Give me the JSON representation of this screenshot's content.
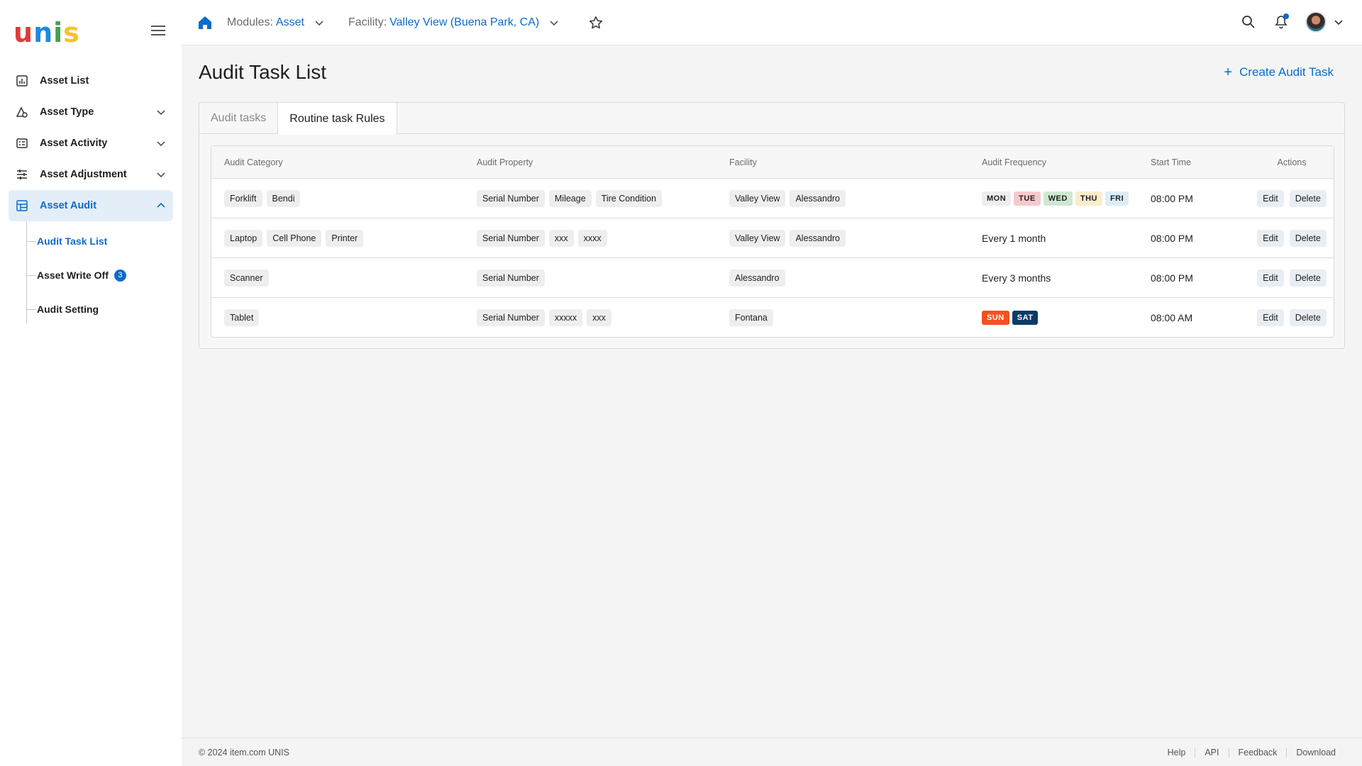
{
  "brand": {
    "letters": [
      {
        "ch": "u",
        "color": "#e53935"
      },
      {
        "ch": "n",
        "color": "#1e88e5"
      },
      {
        "ch": "i",
        "color": "#43a047"
      },
      {
        "ch": "s",
        "color": "#fbc02d"
      }
    ]
  },
  "sidebar": {
    "items": [
      {
        "label": "Asset List",
        "icon": "bar-chart-icon"
      },
      {
        "label": "Asset Type",
        "icon": "shapes-icon"
      },
      {
        "label": "Asset Activity",
        "icon": "activity-list-icon"
      },
      {
        "label": "Asset Adjustment",
        "icon": "sliders-icon"
      },
      {
        "label": "Asset Audit",
        "icon": "grid-icon"
      }
    ],
    "sub_items": [
      {
        "label": "Audit Task List"
      },
      {
        "label": "Asset Write Off",
        "badge": "3"
      },
      {
        "label": "Audit Setting"
      }
    ]
  },
  "topbar": {
    "modules_label": "Modules:",
    "modules_value": "Asset",
    "facility_label": "Facility:",
    "facility_value": "Valley View (Buena Park, CA)"
  },
  "page": {
    "title": "Audit Task List",
    "create_button": "Create Audit Task",
    "tabs": [
      "Audit tasks",
      "Routine task Rules"
    ],
    "active_tab": 1
  },
  "table": {
    "headers": [
      "Audit Category",
      "Audit Property",
      "Facility",
      "Audit Frequency",
      "Start Time",
      "Actions"
    ],
    "edit_label": "Edit",
    "delete_label": "Delete",
    "day_colors": {
      "MON": {
        "bg": "#eeeeee",
        "fg": "#1f1f1f"
      },
      "TUE": {
        "bg": "#f8c9cc",
        "fg": "#1f1f1f"
      },
      "WED": {
        "bg": "#cfe8d2",
        "fg": "#1f1f1f"
      },
      "THU": {
        "bg": "#fbeccb",
        "fg": "#1f1f1f"
      },
      "FRI": {
        "bg": "#dcedf8",
        "fg": "#1f1f1f"
      },
      "SUN": {
        "bg": "#f4511e",
        "fg": "#ffffff"
      },
      "SAT": {
        "bg": "#0d3b66",
        "fg": "#ffffff"
      }
    },
    "rows": [
      {
        "category": [
          "Forklift",
          "Bendi"
        ],
        "property": [
          "Serial Number",
          "Mileage",
          "Tire Condition"
        ],
        "facility": [
          "Valley View",
          "Alessandro"
        ],
        "frequency_days": [
          "MON",
          "TUE",
          "WED",
          "THU",
          "FRI"
        ],
        "frequency_text": "",
        "start_time": "08:00 PM"
      },
      {
        "category": [
          "Laptop",
          "Cell Phone",
          "Printer"
        ],
        "property": [
          "Serial Number",
          "xxx",
          "xxxx"
        ],
        "facility": [
          "Valley View",
          "Alessandro"
        ],
        "frequency_days": [],
        "frequency_text": "Every 1 month",
        "start_time": "08:00 PM"
      },
      {
        "category": [
          "Scanner"
        ],
        "property": [
          "Serial Number"
        ],
        "facility": [
          "Alessandro"
        ],
        "frequency_days": [],
        "frequency_text": "Every 3 months",
        "start_time": "08:00 PM"
      },
      {
        "category": [
          "Tablet"
        ],
        "property": [
          "Serial Number",
          "xxxxx",
          "xxx"
        ],
        "facility": [
          "Fontana"
        ],
        "frequency_days": [
          "SUN",
          "SAT"
        ],
        "frequency_text": "",
        "start_time": "08:00 AM"
      }
    ]
  },
  "footer": {
    "copyright": "© 2024 item.com UNIS",
    "links": [
      "Help",
      "API",
      "Feedback",
      "Download"
    ]
  }
}
